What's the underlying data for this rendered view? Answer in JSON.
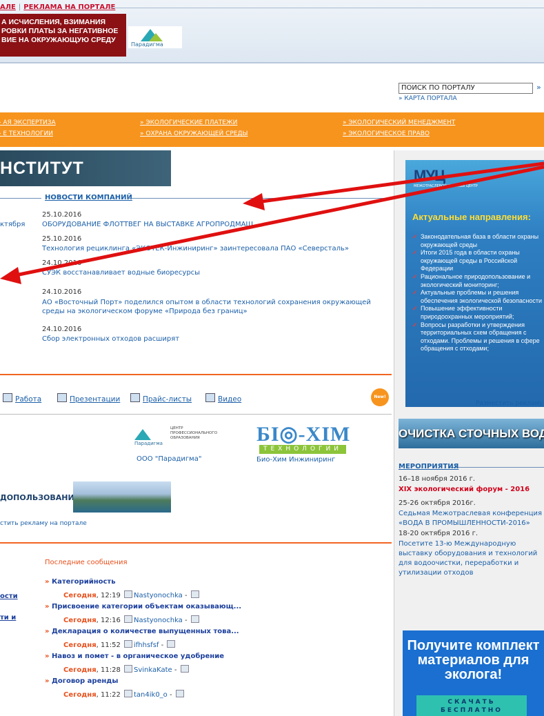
{
  "header": {
    "topline": {
      "link1": "АЛЕ",
      "link2": "РЕКЛАМА НА ПОРТАЛЕ"
    },
    "banner_lines": [
      "А ИСЧИСЛЕНИЯ, ВЗИМАНИЯ",
      "РОВКИ ПЛАТЫ ЗА НЕГАТИВНОЕ",
      "ВИЕ НА ОКРУЖАЮЩУЮ СРЕДУ"
    ],
    "banner_logo_text": "Парадигма"
  },
  "search": {
    "placeholder": "ПОИСК ПО ПОРТАЛУ",
    "go": "»",
    "sitemap": "» КАРТА ПОРТАЛА"
  },
  "nav": {
    "items": [
      "АЯ ЭКСПЕРТИЗА",
      "ЭКОЛОГИЧЕСКИЕ ПЛАТЕЖИ",
      "ЭКОЛОГИЧЕСКИЙ МЕНЕДЖМЕНТ",
      "Е ТЕХНОЛОГИИ",
      "ОХРАНА ОКРУЖАЮЩЕЙ СРЕДЫ",
      "ЭКОЛОГИЧЕСКОЕ ПРАВО"
    ]
  },
  "institute": {
    "title": "НСТИТУТ ЭКОЛОГИИ"
  },
  "news": {
    "title": "НОВОСТИ КОМПАНИЙ",
    "left_stub": "ктября",
    "items": [
      {
        "date": "25.10.2016",
        "text": "ОБОРУДОВАНИЕ ФЛОТТВЕГ НА ВЫСТАВКЕ АГРОПРОДМАШ"
      },
      {
        "date": "25.10.2016",
        "text": "Технология рециклинга «ЭКОТЕК-Инжиниринг» заинтересовала ПАО «Северсталь»"
      },
      {
        "date": "24.10.2016",
        "text": "СУЭК восстанавливает водные биоресурсы"
      },
      {
        "date": "24.10.2016",
        "text": "АО «Восточный Порт» поделился опытом в области технологий сохранения окружающей среды на экологическом форуме «Природа без границ»"
      },
      {
        "date": "24.10.2016",
        "text": "Сбор электронных отходов расширят"
      }
    ]
  },
  "resources": {
    "items": [
      "Работа",
      "Презентации",
      "Прайс-листы",
      "Видео"
    ],
    "new_badge": "New!"
  },
  "partners": {
    "p1_logo_lines": [
      "ЦЕНТР",
      "ПРОФЕССИОНАЛЬНОГО",
      "ОБРАЗОВАНИЯ"
    ],
    "p1_brand": "Парадигма",
    "p1": "ООО \"Парадигма\"",
    "p2_logo": "БІ◎-ХІМ",
    "p2_sub": "ТЕХНОЛОГИИ",
    "p2": "Био-Хим Инжиниринг"
  },
  "nature": {
    "title": "ДОПОЛЬЗОВАНИЯ",
    "place_ad": "стить рекламу на портале"
  },
  "forum": {
    "title": "Последние сообщения",
    "left_items": [
      "ости",
      "ти и"
    ],
    "posts": [
      {
        "title": "Категорийность",
        "day": "Сегодня",
        "time": ", 12:19",
        "user": "Nastyonochka"
      },
      {
        "title": "Присвоение категории объектам оказывающ...",
        "day": "Сегодня",
        "time": ", 12:16",
        "user": "Nastyonochka"
      },
      {
        "title": "Декларация о количестве выпущенных това...",
        "day": "Сегодня",
        "time": ", 11:52",
        "user": "ifhhsfsf"
      },
      {
        "title": "Навоз и помет - в органическое удобрение",
        "day": "Сегодня",
        "time": ", 11:28",
        "user": "SvinkaKate"
      },
      {
        "title": "Договор аренды",
        "day": "Сегодня",
        "time": ", 11:22",
        "user": "tan4ik0_o"
      }
    ]
  },
  "right": {
    "ad1": {
      "logo": "МУЦ",
      "logo_sub": "МЕЖОТРАСЛЕВОЙ УЧЕБНЫЙ ЦЕНТР",
      "head": "Актуальные направления:",
      "list": [
        "Законодательная база в области охраны окружающей среды",
        "Итоги 2015 года в области охраны окружающей среды в Российской Федерации",
        "Рациональное природопользование и экологический мониторинг;",
        "Актуальные проблемы и решения обеспечения экологической безопасности",
        "Повышение эффективности природоохранных мероприятий;",
        "Вопросы разработки и утверждения территориальных схем обращения с отходами. Проблемы и решения в сфере обращения с отходами;"
      ]
    },
    "place_ad": "Разместить рекламу",
    "ad2": "ОЧИСТКА СТОЧНЫХ ВОД",
    "events": {
      "title": "МЕРОПРИЯТИЯ",
      "items": [
        {
          "date": "16–18 ноября 2016 г.",
          "text": "XIX экологический форум - 2016"
        },
        {
          "date": "25-26 октября 2016г.",
          "text": "Седьмая Межотраслевая конференция «ВОДА В ПРОМЫШЛЕННОСТИ-2016»"
        },
        {
          "date": "18-20 октября 2016 г.",
          "text": "Посетите 13-ю Международную выставку оборудования и технологий для водоочистки, переработки и утилизации отходов"
        }
      ]
    },
    "ad3": {
      "title": "Получите комплект материалов для эколога!",
      "button": "СКАЧАТЬ БЕСПЛАТНО"
    }
  }
}
